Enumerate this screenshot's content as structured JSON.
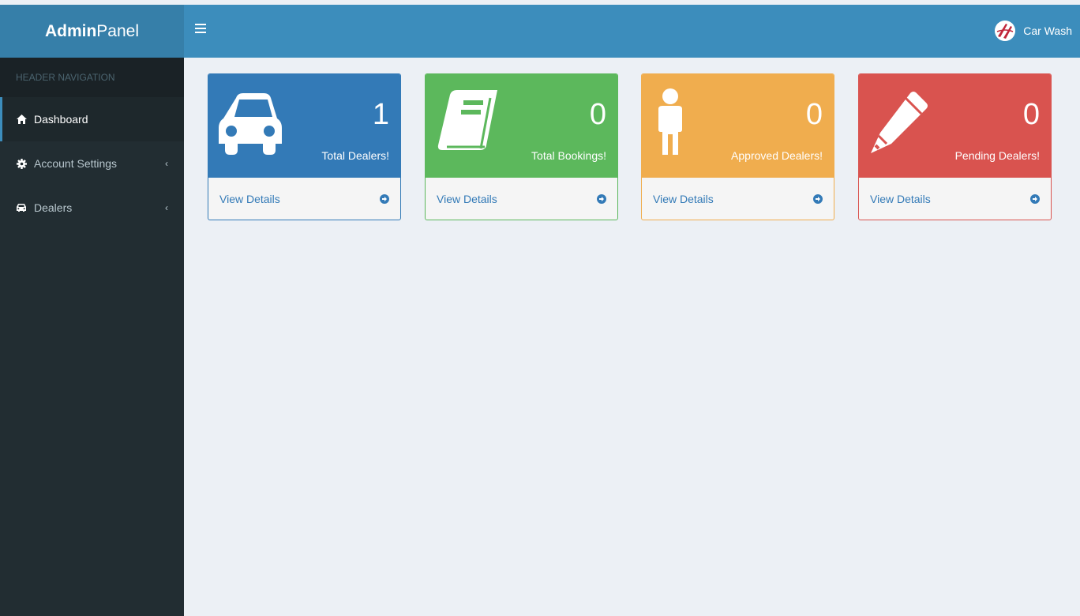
{
  "header": {
    "logo_bold": "Admin",
    "logo_rest": "Panel",
    "brand_name": "Car Wash"
  },
  "sidebar": {
    "header": "HEADER NAVIGATION",
    "items": [
      {
        "label": "Dashboard",
        "icon": "home-icon",
        "active": true
      },
      {
        "label": "Account Settings",
        "icon": "gear-icon"
      },
      {
        "label": "Dealers",
        "icon": "car-icon"
      }
    ]
  },
  "cards": [
    {
      "count": "1",
      "label": "Total Dealers!",
      "link": "View Details",
      "icon": "car-icon",
      "color": "#337ab7"
    },
    {
      "count": "0",
      "label": "Total Bookings!",
      "link": "View Details",
      "icon": "book-icon",
      "color": "#5cb85c"
    },
    {
      "count": "0",
      "label": "Approved Dealers!",
      "link": "View Details",
      "icon": "person-icon",
      "color": "#f0ad4e"
    },
    {
      "count": "0",
      "label": "Pending Dealers!",
      "link": "View Details",
      "icon": "pencil-icon",
      "color": "#d9534f"
    }
  ]
}
